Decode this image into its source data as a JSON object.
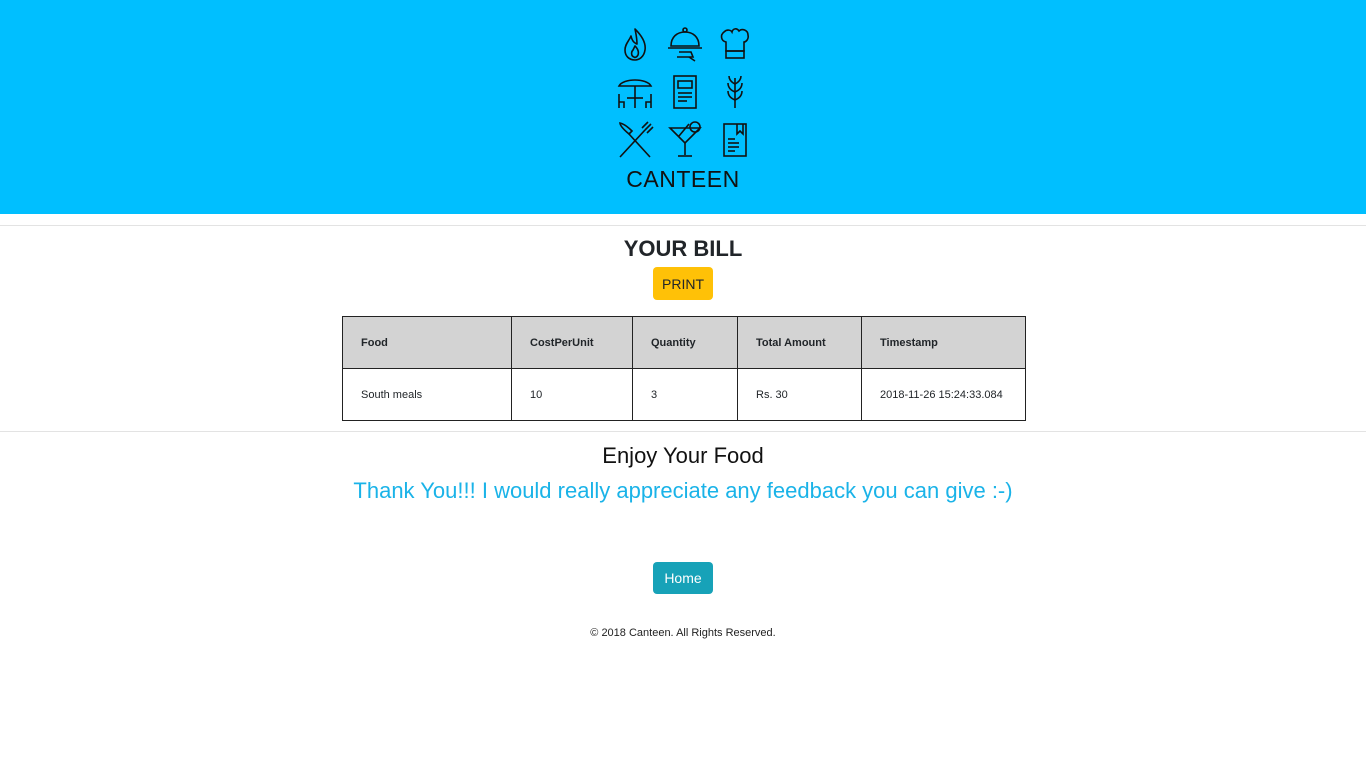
{
  "brand": {
    "name": "CANTEEN",
    "icons": [
      "flame-icon",
      "cloche-icon",
      "chef-hat-icon",
      "umbrella-table-icon",
      "menu-card-icon",
      "wheat-icon",
      "fork-knife-icon",
      "cocktail-icon",
      "recipe-book-icon"
    ]
  },
  "bill": {
    "title": "YOUR BILL",
    "print_label": "PRINT",
    "columns": [
      "Food",
      "CostPerUnit",
      "Quantity",
      "Total Amount",
      "Timestamp"
    ],
    "rows": [
      [
        "South meals",
        "10",
        "3",
        "Rs. 30",
        "2018-11-26 15:24:33.084"
      ]
    ]
  },
  "message": {
    "enjoy": "Enjoy Your Food",
    "thanks": "Thank You!!! I would really appreciate any feedback you can give :-)"
  },
  "home_label": "Home",
  "footer": "© 2018 Canteen. All Rights Reserved.",
  "colors": {
    "header_bg": "#00bfff",
    "print_button": "#ffc107",
    "home_button": "#17a2b8",
    "thanks_text": "#1ab3e8",
    "table_header_bg": "#d3d3d3"
  }
}
